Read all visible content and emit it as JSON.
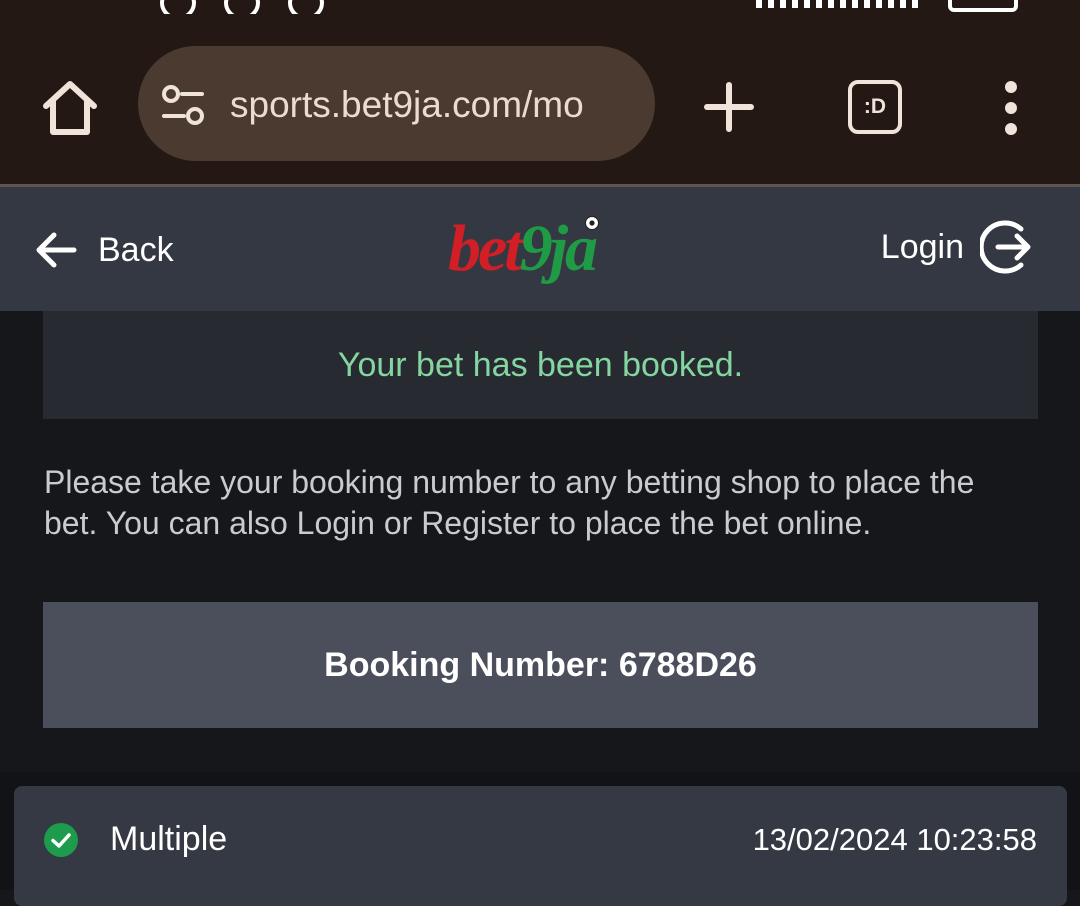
{
  "browser": {
    "url": "sports.bet9ja.com/mo",
    "tabs_label": ":D"
  },
  "header": {
    "back_label": "Back",
    "logo_text_1": "bet",
    "logo_text_2": "9ja",
    "login_label": "Login"
  },
  "content": {
    "booked_message": "Your bet has been booked.",
    "instructions": "Please take your booking number to any betting shop to place the bet. You can also Login or Register to place the bet online.",
    "booking_number": "Booking Number: 6788D26"
  },
  "bet_card": {
    "type": "Multiple",
    "timestamp": "13/02/2024 10:23:58"
  },
  "colors": {
    "logo_red": "#d21f26",
    "logo_green": "#1f9a45",
    "success_text": "#84d5a0",
    "check_green": "#1e9b4d"
  }
}
